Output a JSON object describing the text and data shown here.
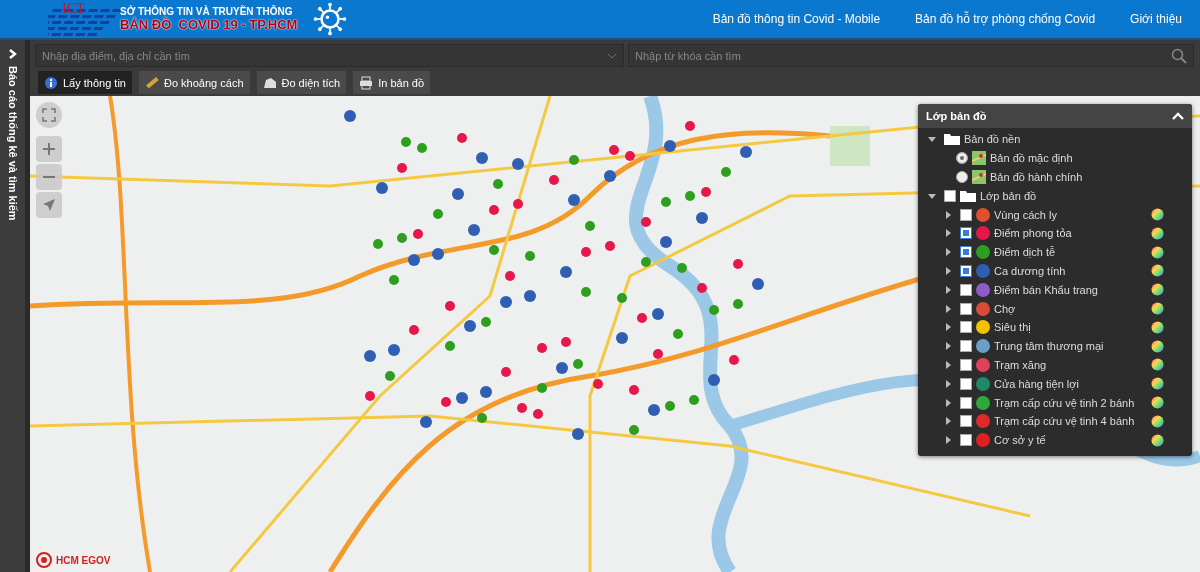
{
  "header": {
    "logo": "ICT",
    "org": "SỞ THÔNG TIN VÀ TRUYỀN THÔNG",
    "title": "BẢN ĐỒ  COVID 19 - TP.HCM",
    "nav": [
      {
        "label": "Bản đồ thông tin Covid - Mobile"
      },
      {
        "label": "Bản đồ hỗ trợ phòng chống Covid"
      },
      {
        "label": "Giới thiệu"
      }
    ]
  },
  "sidebar": {
    "label": "Báo cáo thống kê và tìm kiếm"
  },
  "search": {
    "address_placeholder": "Nhập địa điểm, địa chỉ cần tìm",
    "keyword_placeholder": "Nhập từ khóa cần tìm"
  },
  "toolbar": [
    {
      "label": "Lấy thông tin",
      "kind": "info",
      "selected": true
    },
    {
      "label": "Đo khoảng cách",
      "kind": "ruler",
      "selected": false
    },
    {
      "label": "Đo diện tích",
      "kind": "area",
      "selected": false
    },
    {
      "label": "In bản đồ",
      "kind": "print",
      "selected": false
    }
  ],
  "layer_panel": {
    "title": "Lớp bản đồ",
    "expanded": true,
    "groups": [
      {
        "label": "Bản đồ nền",
        "kind": "radio",
        "expanded": true,
        "children": [
          {
            "label": "Bản đồ mặc định",
            "selected": true
          },
          {
            "label": "Bản đồ hành chính",
            "selected": false
          }
        ]
      },
      {
        "label": "Lớp bản đồ",
        "kind": "check",
        "expanded": true,
        "checked": false,
        "children": [
          {
            "label": "Vùng cách ly",
            "checked": false,
            "expanded": false,
            "color": "#e05030"
          },
          {
            "label": "Điểm phong tỏa",
            "checked": true,
            "expanded": false,
            "color": "#e8174a"
          },
          {
            "label": "Điểm dịch tễ",
            "checked": true,
            "expanded": false,
            "color": "#2e9e1f"
          },
          {
            "label": "Ca dương tính",
            "checked": true,
            "expanded": false,
            "color": "#2f5fb3"
          },
          {
            "label": "Điểm bán Khẩu trang",
            "checked": false,
            "expanded": false,
            "color": "#8e5cc8"
          },
          {
            "label": "Chợ",
            "checked": false,
            "expanded": false,
            "color": "#d94a3a"
          },
          {
            "label": "Siêu thị",
            "checked": false,
            "expanded": false,
            "color": "#f2c200"
          },
          {
            "label": "Trung tâm thương mại",
            "checked": false,
            "expanded": false,
            "color": "#6aa0c8"
          },
          {
            "label": "Trạm xăng",
            "checked": false,
            "expanded": false,
            "color": "#e0405a"
          },
          {
            "label": "Cửa hàng tiện lợi",
            "checked": false,
            "expanded": false,
            "color": "#1f8a6a"
          },
          {
            "label": "Trạm cấp cứu vệ tinh 2 bánh",
            "checked": false,
            "expanded": false,
            "color": "#2eaa3a"
          },
          {
            "label": "Trạm cấp cứu vệ tinh 4 bánh",
            "checked": false,
            "expanded": false,
            "color": "#e02a2a"
          },
          {
            "label": "Cơ sở y tế",
            "checked": false,
            "expanded": false,
            "color": "#e02020"
          }
        ]
      }
    ]
  },
  "map": {
    "credit": "HCM EGOV"
  }
}
